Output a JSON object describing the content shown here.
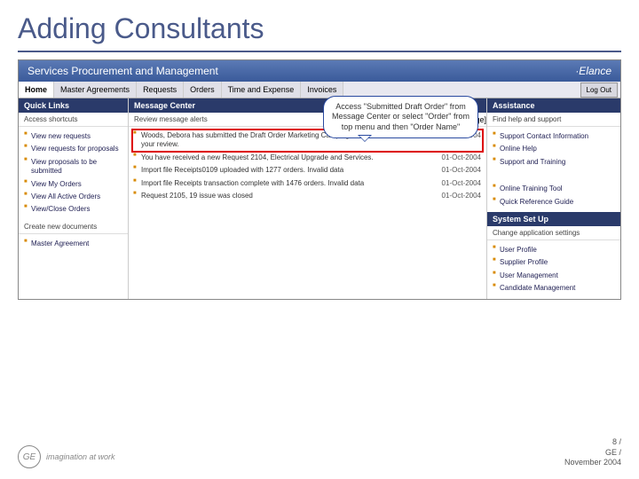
{
  "slide": {
    "title": "Adding Consultants"
  },
  "banner": {
    "title": "Services Procurement and Management",
    "brand": "·Elance"
  },
  "nav": {
    "tabs": [
      "Home",
      "Master Agreements",
      "Requests",
      "Orders",
      "Time and Expense",
      "Invoices"
    ],
    "active": 0,
    "right": [
      "Log Out"
    ]
  },
  "callout": "Access \"Submitted Draft Order\" from Message Center or select \"Order\" from top menu and then \"Order Name\"",
  "left": {
    "head": "Quick Links",
    "sub": "Access shortcuts",
    "items": [
      "View new requests",
      "View requests for proposals",
      "View proposals to be submitted",
      "View My Orders",
      "View All Active Orders",
      "View/Close Orders"
    ],
    "head2": "Create new documents",
    "items2": [
      "Master Agreement"
    ]
  },
  "center": {
    "head": "Message Center",
    "manage": "[Manage]",
    "sub": "Review message alerts",
    "msgs": [
      {
        "txt": "Woods, Debora has submitted the Draft Order Marketing Campaign and Services, 7843 for your review.",
        "date": "01-Oct-2004",
        "hl": true
      },
      {
        "txt": "You have received a new Request 2104, Electrical Upgrade and Services.",
        "date": "01-Oct-2004",
        "hl": false
      },
      {
        "txt": "Import file Receipts0109 uploaded with 1277 orders. Invalid data",
        "date": "01-Oct-2004",
        "hl": false
      },
      {
        "txt": "Import file Receipts transaction complete with 1476 orders. Invalid data",
        "date": "01-Oct-2004",
        "hl": false
      },
      {
        "txt": "Request 2105, 19 issue was closed",
        "date": "01-Oct-2004",
        "hl": false
      }
    ]
  },
  "right": {
    "head": "Assistance",
    "sub": "Find help and support",
    "items": [
      "Support Contact Information",
      "Online Help",
      "Support and Training"
    ],
    "items2": [
      "Online Training Tool",
      "Quick Reference Guide"
    ],
    "head2": "System Set Up",
    "sub2": "Change application settings",
    "items3": [
      "User Profile",
      "Supplier Profile",
      "User Management",
      "Candidate Management"
    ]
  },
  "footer": {
    "ge": "GE",
    "tagline": "imagination at work",
    "page": "8 /",
    "org": "GE /",
    "date": "November 2004"
  }
}
